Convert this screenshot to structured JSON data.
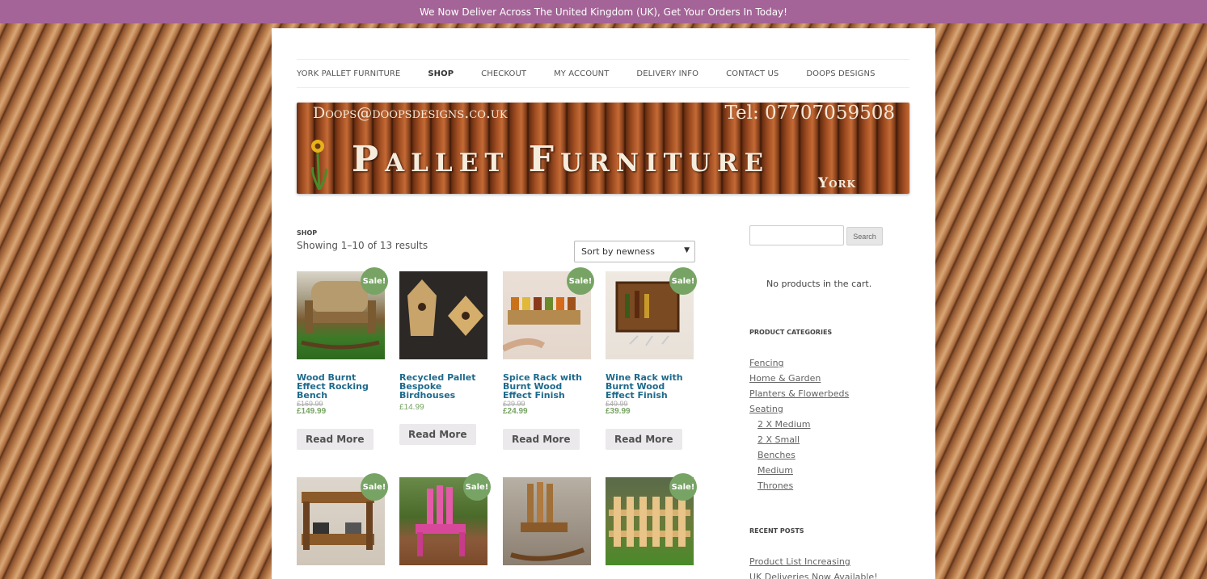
{
  "topbar": {
    "text": "We Now Deliver Across The United Kingdom (UK), Get Your Orders In Today!"
  },
  "nav": {
    "items": [
      "York Pallet Furniture",
      "Shop",
      "Checkout",
      "My Account",
      "Delivery Info",
      "Contact Us",
      "Doops Designs"
    ],
    "active": "Shop"
  },
  "banner": {
    "email": "Doops@doopsdesigns.co.uk",
    "tel": "Tel: 07707059508",
    "title": "Pallet Furniture",
    "sub": "York"
  },
  "shop": {
    "breadcrumb": "Shop",
    "results": "Showing 1–10 of 13 results",
    "sort": "Sort by newness",
    "sale_label": "Sale!",
    "products": [
      {
        "name": "Wood Burnt Effect Rocking Bench",
        "old": "£169.99",
        "price": "£149.99",
        "sale": true,
        "button": "Read More"
      },
      {
        "name": "Recycled Pallet Bespoke Birdhouses",
        "old": "",
        "price": "£14.99",
        "sale": false,
        "button": "Read More"
      },
      {
        "name": "Spice Rack with Burnt Wood Effect Finish",
        "old": "£29.99",
        "price": "£24.99",
        "sale": true,
        "button": "Read More"
      },
      {
        "name": "Wine Rack with Burnt Wood Effect Finish",
        "old": "£49.99",
        "price": "£39.99",
        "sale": true,
        "button": "Read More"
      },
      {
        "sale": true
      },
      {
        "sale": true
      },
      {
        "sale": false
      },
      {
        "sale": true
      }
    ]
  },
  "sidebar": {
    "search_button": "Search",
    "cart_empty": "No products in the cart.",
    "categories_title": "Product Categories",
    "categories": [
      "Fencing",
      "Home & Garden",
      "Planters & Flowerbeds",
      "Seating"
    ],
    "subcategories": [
      "2 X Medium",
      "2 X Small",
      "Benches",
      "Medium",
      "Thrones"
    ],
    "recent_title": "Recent Posts",
    "recent": [
      "Product List Increasing",
      "UK Deliveries Now Available!"
    ]
  },
  "colors": {
    "accent": "#a46497",
    "sale": "#77a464",
    "link": "#1e6a8c"
  }
}
